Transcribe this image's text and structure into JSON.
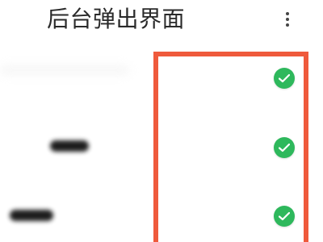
{
  "header": {
    "title": "后台弹出界面"
  },
  "permissions": {
    "items": [
      {
        "state": "enabled",
        "icon": "check-icon"
      },
      {
        "state": "enabled",
        "icon": "check-icon"
      },
      {
        "state": "enabled",
        "icon": "check-icon"
      }
    ]
  },
  "colors": {
    "accent": "#2eb85c",
    "highlight": "#ef5a3c",
    "title": "#2a2a2a"
  }
}
